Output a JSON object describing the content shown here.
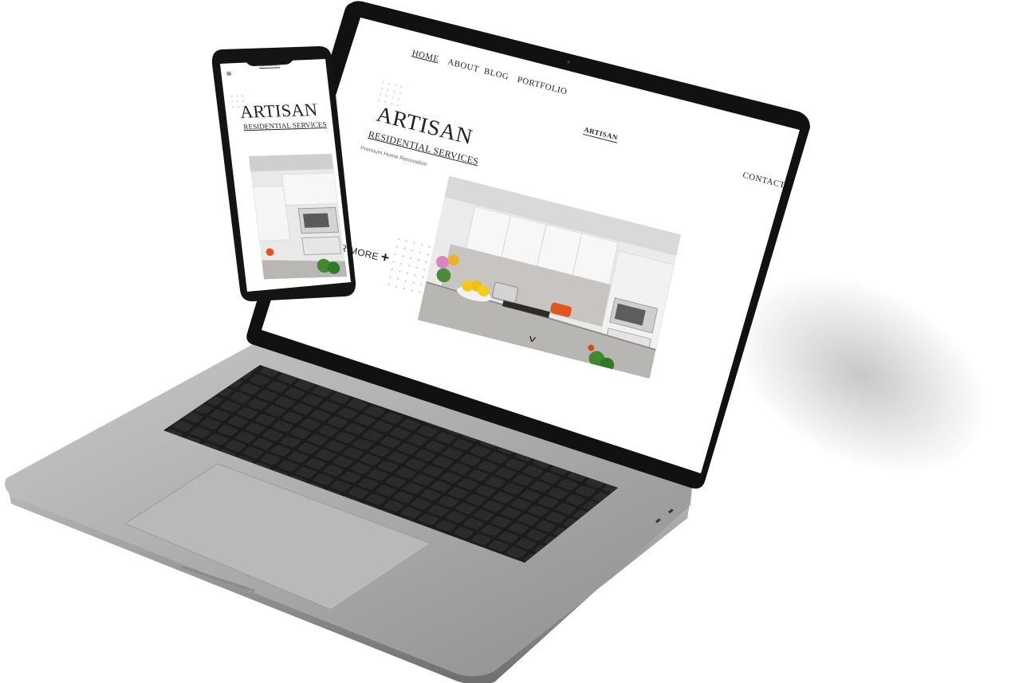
{
  "laptop": {
    "nav": {
      "home": "HOME",
      "about": "ABOUT",
      "blog": "BLOG",
      "portfolio": "PORTFOLIO",
      "contact": "CONTACT"
    },
    "logo": "ARTISAN",
    "hero": {
      "title": "ARTISAN",
      "subtitle": "RESIDENTIAL SERVICES",
      "tagline": "Premium Home Renovation",
      "cta": "COVER MORE",
      "cta_icon": "plus-icon",
      "scroll_icon": "chevron-down-icon",
      "image": "kitchen-photo"
    }
  },
  "phone": {
    "menu_icon": "hamburger-menu-icon",
    "logo": "ARTISAN",
    "hero": {
      "title": "ARTISAN",
      "subtitle": "RESIDENTIAL SERVICES",
      "image": "kitchen-photo"
    }
  },
  "colors": {
    "text": "#222222",
    "page_background": "#ffffff",
    "device_frame": "#1a1a1a",
    "laptop_aluminum": "#a9a9a9",
    "keyboard_keys": "#2a2a2a"
  }
}
